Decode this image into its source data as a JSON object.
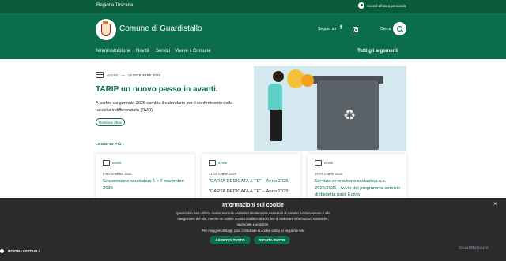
{
  "topbar": {
    "region": "Regione Toscana",
    "login": "Accedi all'area personale"
  },
  "header": {
    "title": "Comune di Guardistallo",
    "follow": "Seguici su",
    "search_label": "Cerca",
    "nav": [
      "Amministrazione",
      "Novità",
      "Servizi",
      "Vivere il Comune"
    ],
    "nav_all": "Tutti gli argomenti"
  },
  "featured": {
    "category": "AVVISI",
    "separator": "—",
    "date": "19 DICEMBRE 2025",
    "title": "TARIP un nuovo passo in avanti.",
    "text": "A partire da gennaio 2026 cambia il calendario per il conferimento della raccolta indifferenziata (RUR).",
    "tag": "Gestione rifiuti",
    "read_more": "LEGGI DI PIÙ"
  },
  "cards": [
    {
      "category": "avvisi",
      "date": "5 NOVEMBRE 2025",
      "title": "Sospensione scuolabus 6 e 7 novembre 2025",
      "extra": ""
    },
    {
      "category": "avvisi",
      "date": "31 OTTOBRE 2025",
      "title": "\"CARTA DEDICATA A TE\" – Anno 2025",
      "extra": "\"CARTA DEDICATA A TE\" – Anno 2025"
    },
    {
      "category": "avvisi",
      "date": "29 OTTOBRE 2025",
      "title": "Servizio di refezione scolastica a.s. 2025/2026 - Avvio del programma servizio di disdetta pasti Ecivis",
      "extra": ""
    }
  ],
  "cookie": {
    "title": "Informazioni sui cookie",
    "text": "Questo sito web utilizza cookie tecnici e assimilati strettamente necessari al corretto funzionamento e alla navigazione del sito, mentre un cookie tecnico analitico al solo fine di elaborare informazioni statistiche, aggregate e anonime.",
    "more": "Per maggiori dettagli, puoi consultare la cookie policy al seguente link",
    "accept": "ACCETTA TUTTO",
    "reject": "RIFIUTA TUTTO",
    "details": "MOSTRA DETTAGLI"
  },
  "watermark": "ScanMalware"
}
